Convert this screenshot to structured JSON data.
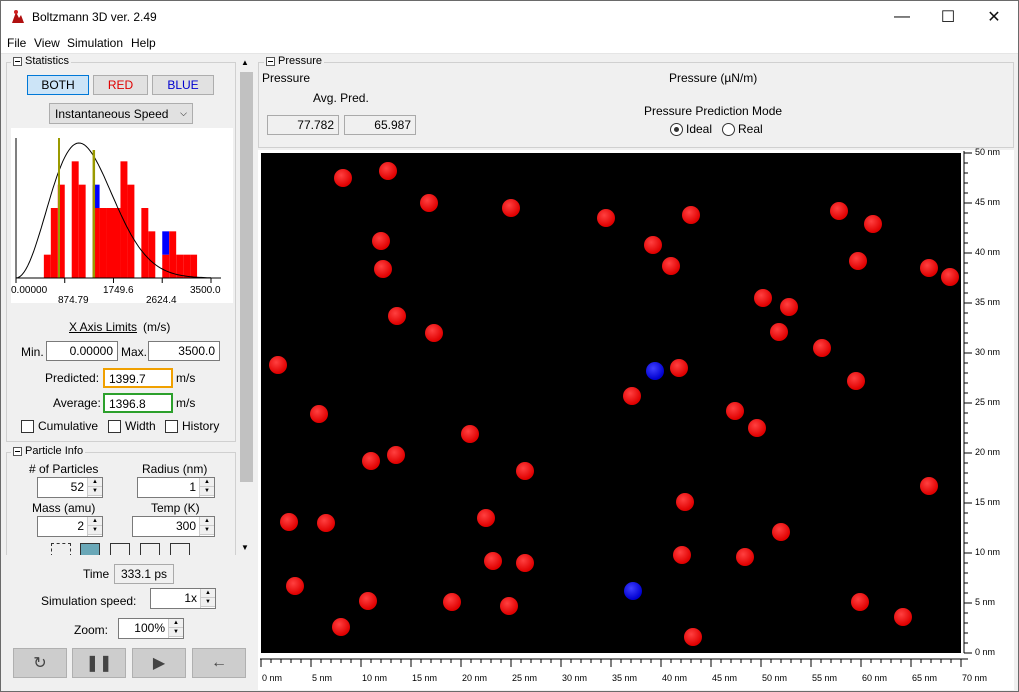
{
  "window": {
    "title": "Boltzmann 3D ver. 2.49",
    "controls": {
      "minimize": "—",
      "maximize": "☐",
      "close": "✕"
    }
  },
  "menu": [
    "File",
    "View",
    "Simulation",
    "Help"
  ],
  "statistics": {
    "title": "Statistics",
    "buttons": {
      "both": "BOTH",
      "red": "RED",
      "blue": "BLUE"
    },
    "dropdown": "Instantaneous Speed",
    "histogram_ticks": [
      "0.00000",
      "874.79",
      "1749.6",
      "2624.4",
      "3500.0"
    ],
    "x_axis_link": "X Axis Limits",
    "x_axis_units": "(m/s)",
    "min_label": "Min.",
    "min_value": "0.00000",
    "max_label": "Max.",
    "max_value": "3500.0",
    "predicted_label": "Predicted:",
    "predicted_value": "1399.7",
    "predicted_units": "m/s",
    "average_label": "Average:",
    "average_value": "1396.8",
    "average_units": "m/s",
    "cumulative": "Cumulative",
    "width": "Width",
    "history": "History",
    "colors": {
      "red": "#ff0000",
      "blue": "#0000ff",
      "predicted_line": "#f0a000",
      "average_line": "#2ca02c"
    }
  },
  "particle_info": {
    "title": "Particle Info",
    "count_label": "# of Particles",
    "count_value": "52",
    "radius_label": "Radius (nm)",
    "radius_value": "1",
    "mass_label": "Mass (amu)",
    "mass_value": "2",
    "temp_label": "Temp (K)",
    "temp_value": "300"
  },
  "bottom_controls": {
    "time_label": "Time",
    "time_value": "333.1 ps",
    "speed_label": "Simulation speed:",
    "speed_value": "1x",
    "zoom_label": "Zoom:",
    "zoom_value": "100%",
    "icons": [
      "reset-icon",
      "pause-icon",
      "play-icon",
      "back-arrow-icon"
    ]
  },
  "pressure": {
    "title": "Pressure",
    "label": "Pressure",
    "avg_pred_label": "Avg. Pred.",
    "avg_value": "77.782",
    "pred_value": "65.987",
    "units_label": "Pressure (µN/m)",
    "mode_label": "Pressure Prediction Mode",
    "ideal": "Ideal",
    "real": "Real",
    "selected_mode": "Ideal"
  },
  "sim_axes": {
    "x_ticks": [
      "0 nm",
      "5 nm",
      "10 nm",
      "15 nm",
      "20 nm",
      "25 nm",
      "30 nm",
      "35 nm",
      "40 nm",
      "45 nm",
      "50 nm",
      "55 nm",
      "60 nm",
      "65 nm",
      "70 nm"
    ],
    "y_ticks": [
      "50 nm",
      "45 nm",
      "40 nm",
      "35 nm",
      "30 nm",
      "25 nm",
      "20 nm",
      "15 nm",
      "10 nm",
      "5 nm",
      "0 nm"
    ]
  },
  "chart_data": {
    "type": "bar",
    "title": "",
    "xlim": [
      0,
      3500
    ],
    "categories": [
      "0-125",
      "125-250",
      "250-375",
      "375-500",
      "500-625",
      "625-750",
      "750-875",
      "875-1000",
      "1000-1125",
      "1125-1250",
      "1250-1375",
      "1375-1500",
      "1500-1625",
      "1625-1750",
      "1750-1875",
      "1875-2000",
      "2000-2125",
      "2125-2250",
      "2250-2375",
      "2375-2500",
      "2500-2625",
      "2625-2750",
      "2750-2875",
      "2875-3000",
      "3000-3125",
      "3125-3250",
      "3250-3375",
      "3375-3500"
    ],
    "series": [
      {
        "name": "RED",
        "values": [
          0,
          0,
          0,
          0,
          1,
          3,
          4,
          0,
          5,
          4,
          0,
          3,
          3,
          3,
          3,
          5,
          4,
          0,
          3,
          2,
          0,
          1,
          2,
          1,
          1,
          1,
          0,
          0
        ]
      },
      {
        "name": "BLUE",
        "values": [
          0,
          0,
          0,
          0,
          0,
          0,
          0,
          0,
          0,
          0,
          0,
          1,
          0,
          0,
          0,
          0,
          0,
          0,
          0,
          0,
          0,
          1,
          0,
          0,
          0,
          0,
          0,
          0
        ]
      }
    ],
    "predicted": 1399.7,
    "average": 1396.8
  }
}
